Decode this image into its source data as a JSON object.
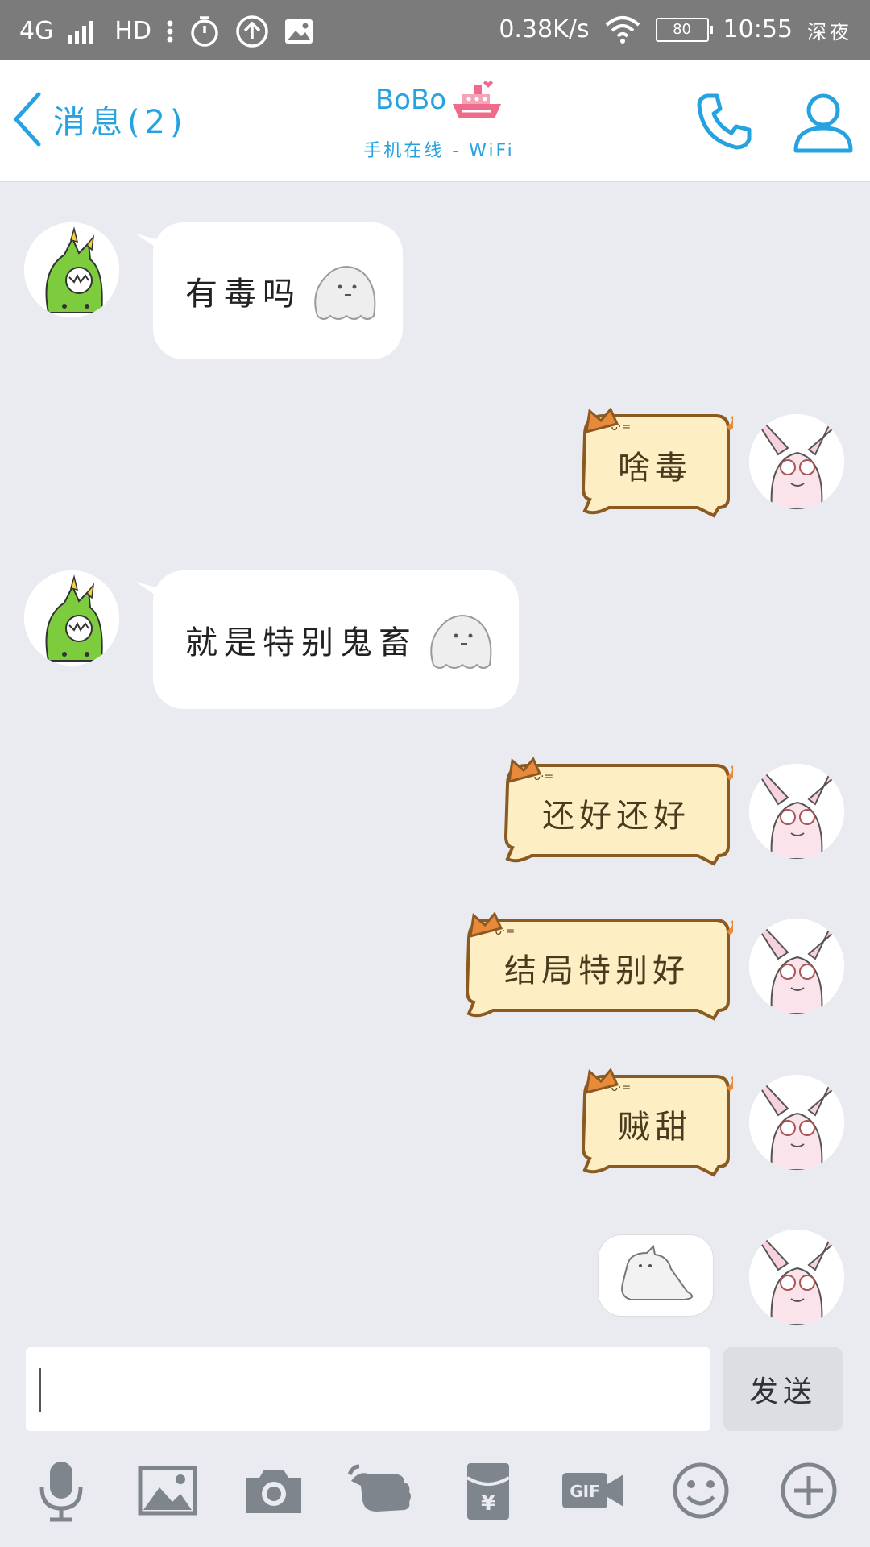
{
  "status_bar": {
    "network": "4G",
    "hd": "HD",
    "speed": "0.38K/s",
    "battery": "80",
    "time": "10:55",
    "period": "深夜"
  },
  "header": {
    "back_label": "消息(2)",
    "contact_name": "BoBo",
    "contact_status": "手机在线 - WiFi"
  },
  "messages": [
    {
      "side": "left",
      "text": "有毒吗",
      "style": "white",
      "emoji": "ghost"
    },
    {
      "side": "right",
      "text": "啥毒",
      "style": "cat"
    },
    {
      "side": "left",
      "text": "就是特别鬼畜",
      "style": "white",
      "emoji": "ghost"
    },
    {
      "side": "right",
      "text": "还好还好",
      "style": "cat"
    },
    {
      "side": "right",
      "text": "结局特别好",
      "style": "cat"
    },
    {
      "side": "right",
      "text": "贼甜",
      "style": "cat"
    },
    {
      "side": "right",
      "text": "",
      "style": "sticker"
    }
  ],
  "input": {
    "value": "",
    "send_label": "发送"
  },
  "toolbar": {
    "items": [
      "microphone-icon",
      "image-icon",
      "camera-icon",
      "poke-hand-icon",
      "red-packet-icon",
      "gif-icon",
      "emoji-icon",
      "plus-icon"
    ]
  },
  "colors": {
    "accent": "#26a2e0",
    "chat_bg": "#e9ebf0",
    "cat_bubble": "#fdefc3",
    "cat_outline": "#8a5a22"
  }
}
